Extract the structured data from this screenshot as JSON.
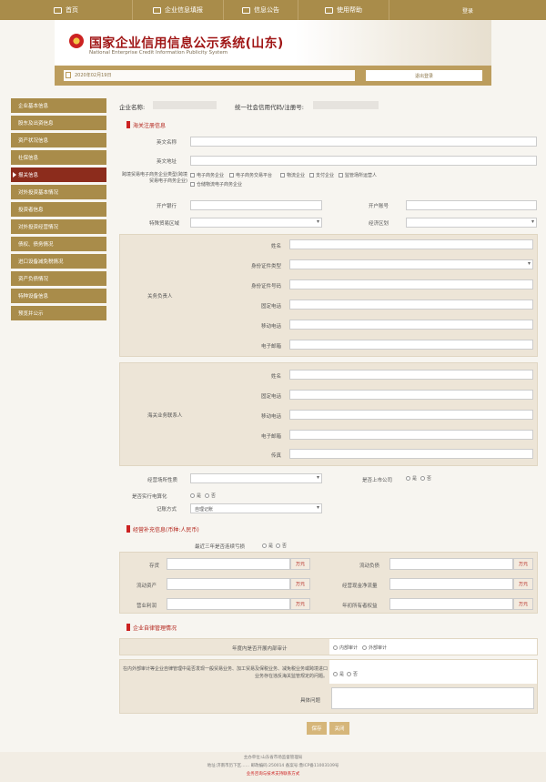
{
  "nav": {
    "items": [
      {
        "label": "首页"
      },
      {
        "label": "企业信息填报"
      },
      {
        "label": "信息公告"
      },
      {
        "label": "使用帮助"
      }
    ],
    "login": "登录"
  },
  "site": {
    "title": "国家企业信用信息公示系统(山东)",
    "subtitle": "National Enterprise Credit Information Publicity System"
  },
  "bar": {
    "date": "2020年02月19日",
    "logout": "退出登录"
  },
  "sidebar": {
    "items": [
      {
        "label": "企业基本信息"
      },
      {
        "label": "股东及出资信息"
      },
      {
        "label": "资产状况信息"
      },
      {
        "label": "社保信息"
      },
      {
        "label": "报关信息"
      },
      {
        "label": "对外投资基本情况"
      },
      {
        "label": "投资者信息"
      },
      {
        "label": "对外投资经营情况"
      },
      {
        "label": "债权、债务情况"
      },
      {
        "label": "进口设备减免税情况"
      },
      {
        "label": "资产负债情况"
      },
      {
        "label": "特种设备信息"
      },
      {
        "label": "预览并公示"
      }
    ]
  },
  "company": {
    "name_label": "企业名称:",
    "credit_label": "统一社会信用代码/注册号:"
  },
  "customs": {
    "title": "海关注册信息",
    "cn_name": "英文名称",
    "en_addr": "英文地址",
    "crossborder_label": "跨境贸易电子商务企业类型(跨境贸易电子商务企业)",
    "options": [
      "电子商务企业",
      "电子商务交易平台",
      "物流企业",
      "支付企业",
      "监管场所运营人",
      "仓储物流电子商务企业"
    ],
    "bank": "开户银行",
    "account": "开户账号",
    "special_area": "特殊贸易区域",
    "economic_zone": "经济区划"
  },
  "legal": {
    "group": "关务负责人",
    "fields": [
      "姓名",
      "身份证件类型",
      "身份证件号码",
      "固定电话",
      "移动电话",
      "电子邮箱"
    ]
  },
  "contact": {
    "group": "海关业务联系人",
    "fields": [
      "姓名",
      "固定电话",
      "移动电话",
      "电子邮箱",
      "传真"
    ]
  },
  "misc": {
    "premises": "经营场所性质",
    "listed": "是否上市公司",
    "yes": "是",
    "no": "否",
    "ecommerce": "是否实行电算化",
    "bookkeeping": "记账方式",
    "bookkeeping_value": "自理记账"
  },
  "finance": {
    "title": "经营补充信息(币种:人民币)",
    "question": "最近三年是否连续亏损",
    "fields": [
      "存货",
      "流动负债",
      "流动资产",
      "经营现金净流量",
      "营业利润",
      "年初所有者权益"
    ],
    "unit": "万元"
  },
  "audit": {
    "title": "企业自律管理情况",
    "q1": "年度内是否开展内部审计",
    "opt1": "内部审计",
    "opt2": "外部审计",
    "q2": "在内外部审计等企业自律管理中是否发现一般贸易业务、加工贸易及保税业务、减免税业务或跨境进口业务存在违反海关监管规定的问题。",
    "detail": "具体问题"
  },
  "buttons": {
    "save": "保存",
    "close": "关闭"
  },
  "footer": {
    "line1": "主办单位:山东省市场监督管理局",
    "line2": "地址:济南市历下区……  邮政编码:250014  备案号:鲁ICP备11003109号",
    "line3": "业务咨询与技术支持联系方式"
  },
  "colors": {
    "gold": "#a98c4a",
    "accent": "#b3231a"
  }
}
